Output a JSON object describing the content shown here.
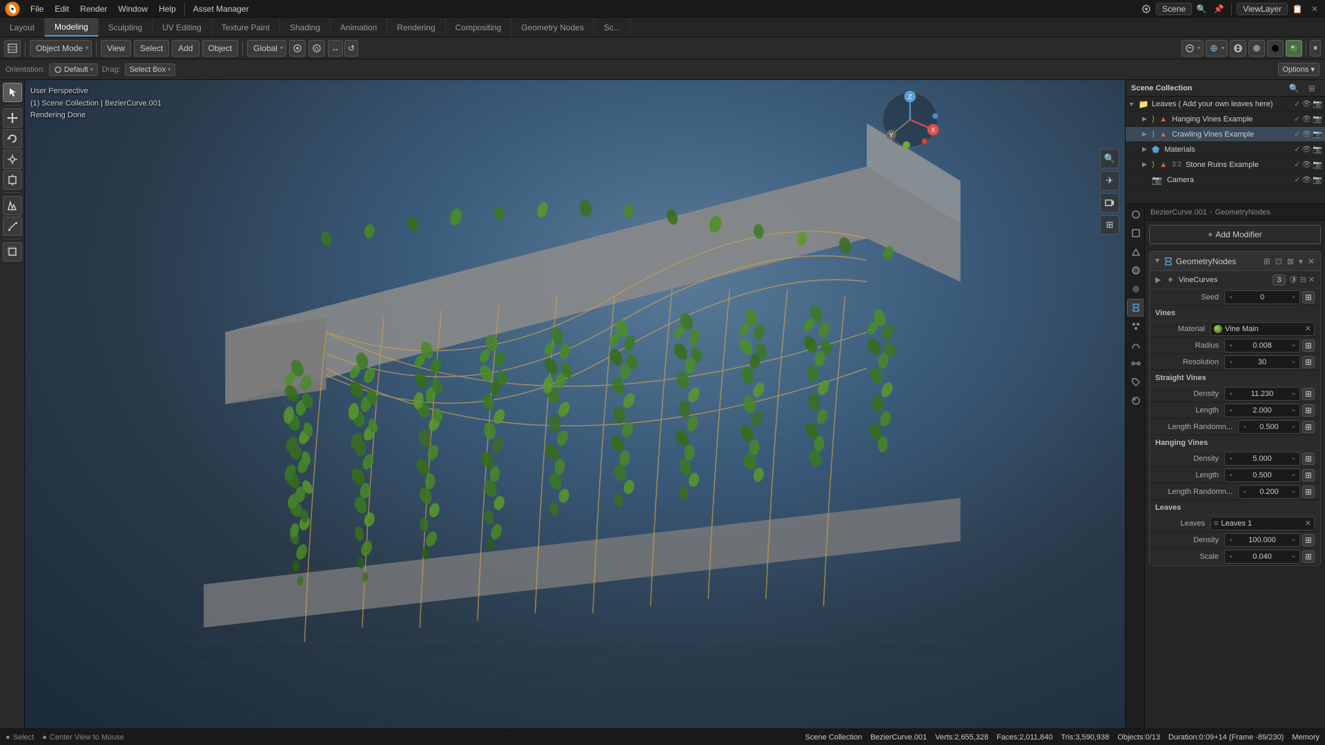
{
  "topMenu": {
    "items": [
      "File",
      "Edit",
      "Render",
      "Window",
      "Help"
    ]
  },
  "assetManager": "Asset Manager",
  "workspaceTabs": [
    {
      "label": "Layout",
      "active": false
    },
    {
      "label": "Modeling",
      "active": true
    },
    {
      "label": "Sculpting",
      "active": false
    },
    {
      "label": "UV Editing",
      "active": false
    },
    {
      "label": "Texture Paint",
      "active": false
    },
    {
      "label": "Shading",
      "active": false
    },
    {
      "label": "Animation",
      "active": false
    },
    {
      "label": "Rendering",
      "active": false
    },
    {
      "label": "Compositing",
      "active": false
    },
    {
      "label": "Geometry Nodes",
      "active": false
    },
    {
      "label": "Sc...",
      "active": false
    }
  ],
  "toolbar": {
    "mode": "Object Mode",
    "view": "View",
    "select": "Select",
    "add": "Add",
    "object": "Object",
    "orientation": "Global",
    "snap_icon": "🧲",
    "drag_label": "Drag:",
    "select_box": "Select Box"
  },
  "header": {
    "orientation_label": "Orientation:",
    "default": "Default",
    "drag_label": "Drag:",
    "select_box": "Select Box",
    "options": "Options ▾"
  },
  "viewport": {
    "info_line1": "User Perspective",
    "info_line2": "(1) Scene Collection | BezierCurve.001",
    "info_line3": "Rendering Done"
  },
  "outliner": {
    "title": "Scene Collection",
    "items": [
      {
        "indent": 0,
        "name": "Leaves ( Add your own leaves here)",
        "icon": "📁",
        "expanded": true
      },
      {
        "indent": 1,
        "name": "Hanging Vines Example",
        "icon": "🌿",
        "expanded": true
      },
      {
        "indent": 1,
        "name": "Crawling Vines Example",
        "icon": "🌿",
        "expanded": true,
        "selected": true
      },
      {
        "indent": 1,
        "name": "Materials",
        "icon": "🔵",
        "expanded": false
      },
      {
        "indent": 1,
        "name": "Stone Ruins Example",
        "icon": "🏚",
        "expanded": false
      },
      {
        "indent": 1,
        "name": "Camera",
        "icon": "📷",
        "expanded": false
      }
    ]
  },
  "propertyTabs": [
    {
      "icon": "▣",
      "label": "Render",
      "active": false
    },
    {
      "icon": "🔲",
      "label": "Output",
      "active": false
    },
    {
      "icon": "🎬",
      "label": "View Layer",
      "active": false
    },
    {
      "icon": "🌍",
      "label": "Scene",
      "active": false
    },
    {
      "icon": "⚙",
      "label": "World",
      "active": false
    },
    {
      "icon": "👁",
      "label": "Object",
      "active": false
    },
    {
      "icon": "✦",
      "label": "Modifier",
      "active": true
    },
    {
      "icon": "●",
      "label": "Particles",
      "active": false
    },
    {
      "icon": "⚡",
      "label": "Physics",
      "active": false
    },
    {
      "icon": "🔗",
      "label": "Constraints",
      "active": false
    },
    {
      "icon": "📐",
      "label": "Data",
      "active": false
    },
    {
      "icon": "🎨",
      "label": "Material",
      "active": false
    }
  ],
  "breadcrumb": {
    "object": "BezierCurve.001",
    "modifier": "GeometryNodes"
  },
  "addModifier": "Add Modifier",
  "modifier": {
    "name": "GeometryNodes",
    "submod": {
      "name": "VineCurves",
      "badge": "3"
    },
    "seed": {
      "label": "Seed",
      "value": "0"
    },
    "vines": {
      "sectionLabel": "Vines",
      "material": {
        "label": "Material",
        "value": "Vine Main"
      },
      "radius": {
        "label": "Radius",
        "value": "0.008"
      },
      "resolution": {
        "label": "Resolution",
        "value": "30"
      }
    },
    "straightVines": {
      "sectionLabel": "Straight Vines",
      "density": {
        "label": "Density",
        "value": "11.230"
      },
      "length": {
        "label": "Length",
        "value": "2.000"
      },
      "lengthRandom": {
        "label": "Length Randomn...",
        "value": "0.500"
      }
    },
    "hangingVines": {
      "sectionLabel": "Hanging Vines",
      "density": {
        "label": "Density",
        "value": "5.000"
      },
      "length": {
        "label": "Length",
        "value": "0.500"
      },
      "lengthRandom": {
        "label": "Length Randomn...",
        "value": "0.200"
      }
    },
    "leaves": {
      "sectionLabel": "Leaves",
      "leaves_label": "Leaves",
      "leaves_value": "Leaves 1",
      "density": {
        "label": "Density",
        "value": "100.000"
      },
      "scale": {
        "label": "Scale",
        "value": "0.040"
      }
    }
  },
  "statusBar": {
    "collection": "Scene Collection",
    "object": "BezierCurve.001",
    "verts": "Verts:2,655,328",
    "faces": "Faces:2,011,840",
    "tris": "Tris:3,590,938",
    "objects": "Objects:0/13",
    "duration": "Duration:0:09+14 (Frame -89/230)",
    "memory": "Memory",
    "select_hint": "Select",
    "center_hint": "Center View to Mouse"
  },
  "scene": "Scene",
  "viewlayer": "ViewLayer",
  "colors": {
    "accent_blue": "#5a9fd4",
    "vine_green": "#4a8a20",
    "bg_dark": "#1a1a1a"
  }
}
